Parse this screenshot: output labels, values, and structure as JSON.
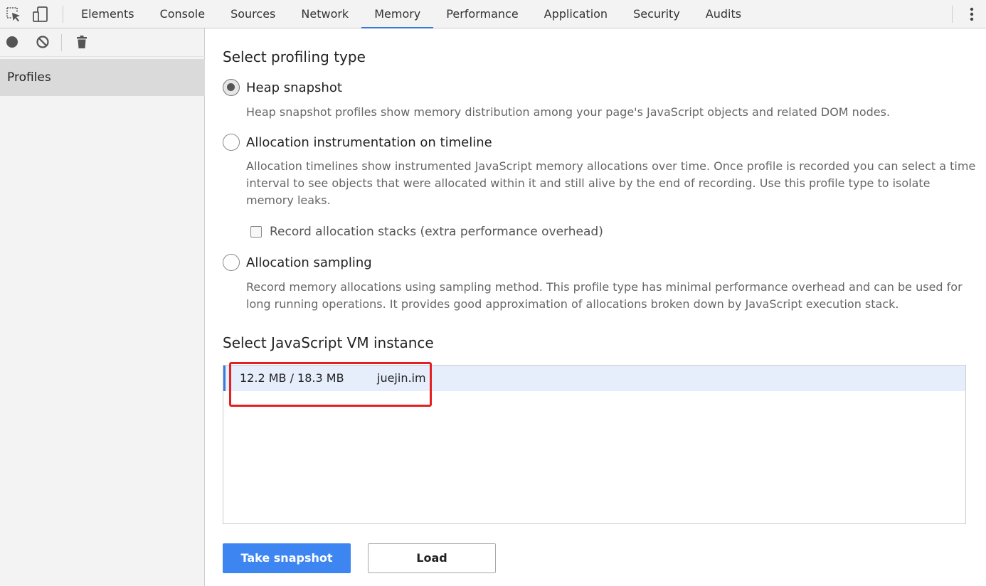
{
  "toolbar": {
    "icons": [
      "inspect-element-icon",
      "device-toolbar-icon",
      "more-options-icon"
    ]
  },
  "tabs": [
    {
      "label": "Elements"
    },
    {
      "label": "Console"
    },
    {
      "label": "Sources"
    },
    {
      "label": "Network"
    },
    {
      "label": "Memory",
      "active": true
    },
    {
      "label": "Performance"
    },
    {
      "label": "Application"
    },
    {
      "label": "Security"
    },
    {
      "label": "Audits"
    }
  ],
  "sidebar": {
    "toolbar_icons": [
      "record-icon",
      "clear-icon",
      "trash-icon"
    ],
    "item_label": "Profiles"
  },
  "main": {
    "profiling_heading": "Select profiling type",
    "options": [
      {
        "label": "Heap snapshot",
        "checked": true,
        "description": "Heap snapshot profiles show memory distribution among your page's JavaScript objects and related DOM nodes."
      },
      {
        "label": "Allocation instrumentation on timeline",
        "checked": false,
        "description": "Allocation timelines show instrumented JavaScript memory allocations over time. Once profile is recorded you can select a time interval to see objects that were allocated within it and still alive by the end of recording. Use this profile type to isolate memory leaks.",
        "checkbox_label": "Record allocation stacks (extra performance overhead)",
        "checkbox_checked": false
      },
      {
        "label": "Allocation sampling",
        "checked": false,
        "description": "Record memory allocations using sampling method. This profile type has minimal performance overhead and can be used for long running operations. It provides good approximation of allocations broken down by JavaScript execution stack."
      }
    ],
    "vm_heading": "Select JavaScript VM instance",
    "vm_instance": {
      "memory": "12.2 MB / 18.3 MB",
      "url": "juejin.im"
    },
    "buttons": {
      "primary": "Take snapshot",
      "secondary": "Load"
    }
  },
  "colors": {
    "accent": "#3879d9",
    "primary_button": "#3d86f2",
    "highlight": "#e62020",
    "selected_row": "#e6eefc"
  }
}
